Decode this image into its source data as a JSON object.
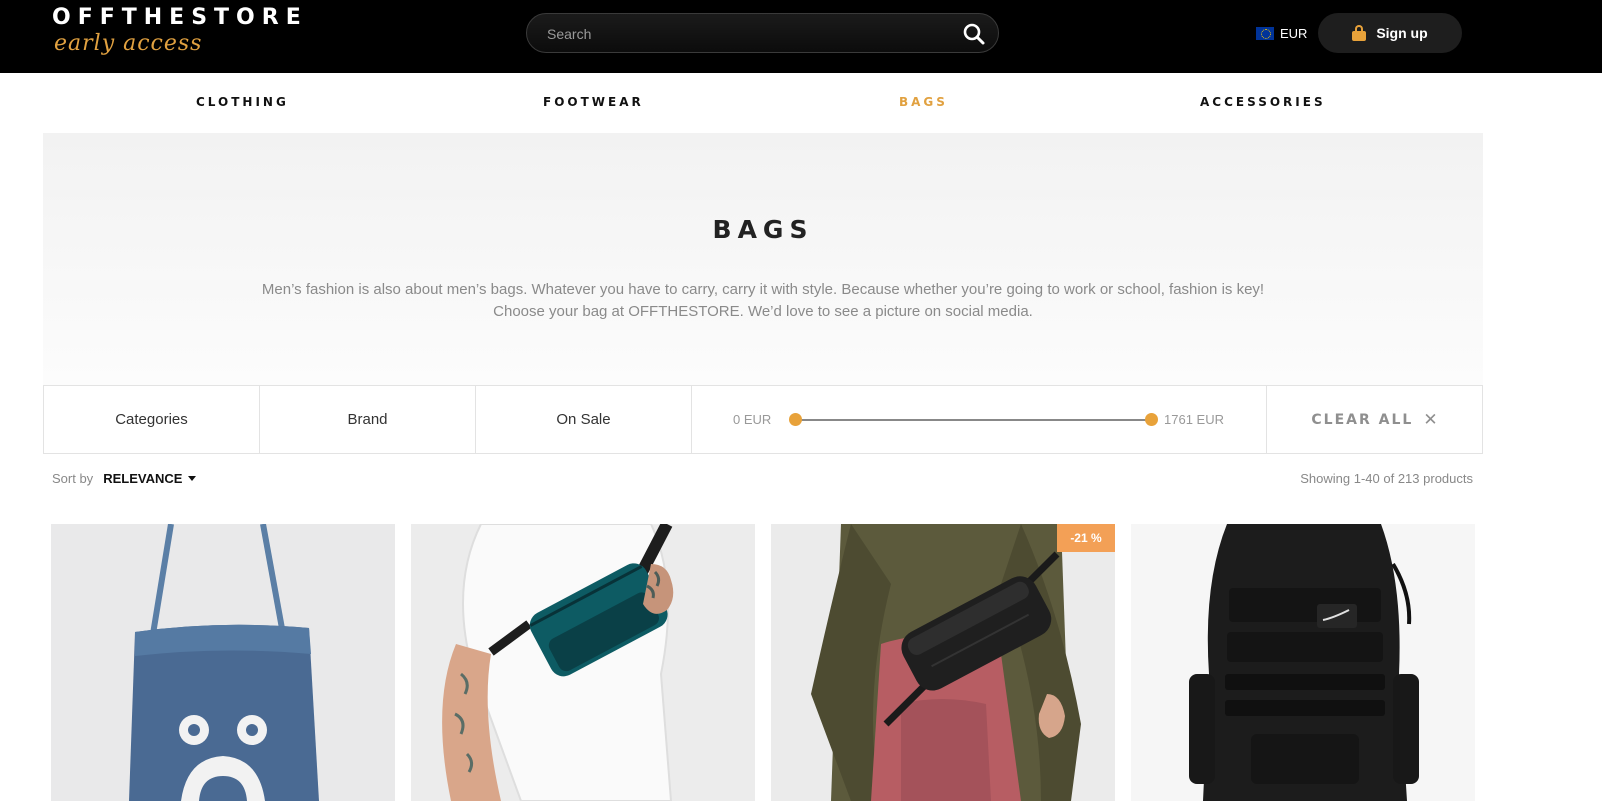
{
  "header": {
    "logo_main": "OFFTHESTORE",
    "logo_sub": "early access",
    "search_placeholder": "Search",
    "currency": "EUR",
    "signup_label": "Sign up"
  },
  "nav": {
    "items": [
      {
        "label": "CLOTHING",
        "active": false
      },
      {
        "label": "FOOTWEAR",
        "active": false
      },
      {
        "label": "BAGS",
        "active": true
      },
      {
        "label": "ACCESSORIES",
        "active": false
      }
    ]
  },
  "hero": {
    "title": "BAGS",
    "description": "Men’s fashion is also about men’s bags. Whatever you have to carry, carry it with style. Because whether you’re going to work or school, fashion is key! Choose your bag at OFFTHESTORE. We’d love to see a picture on social media."
  },
  "filters": {
    "categories": "Categories",
    "brand": "Brand",
    "on_sale": "On Sale",
    "price_min": "0 EUR",
    "price_max": "1761 EUR",
    "clear_all": "CLEAR ALL"
  },
  "sort": {
    "label": "Sort by",
    "value": "RELEVANCE"
  },
  "results": {
    "showing": "Showing 1-40 of 213 products"
  },
  "products": [
    {
      "image": "denim-tote-bag",
      "badge": ""
    },
    {
      "image": "teal-waist-bag",
      "badge": ""
    },
    {
      "image": "black-waist-bag",
      "badge": "-21 %"
    },
    {
      "image": "black-backpack",
      "badge": ""
    }
  ],
  "colors": {
    "accent": "#e1a140",
    "header_bg": "#000000",
    "badge_bg": "#f3a056",
    "slider_knob": "#e8a23a"
  }
}
